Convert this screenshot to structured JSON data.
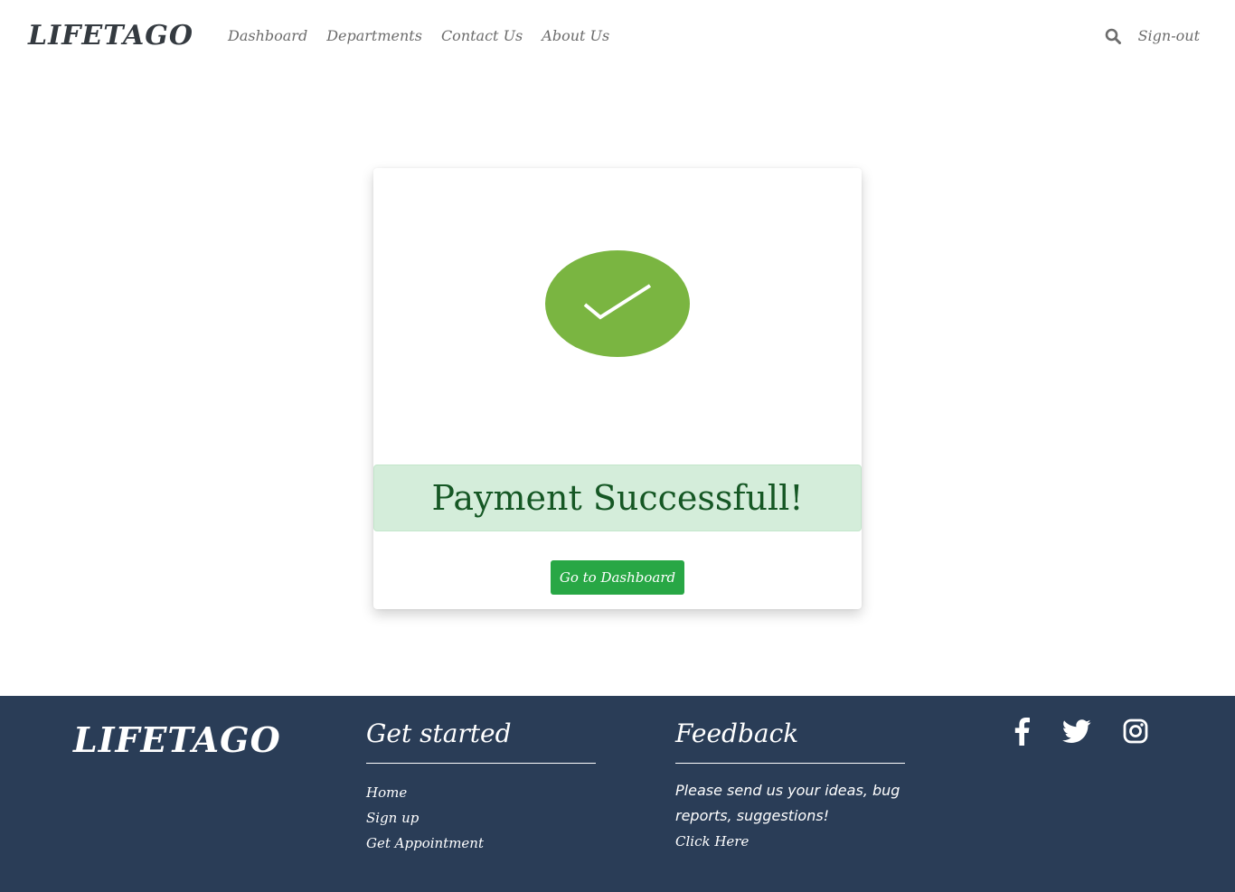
{
  "header": {
    "brand": "LIFETAGO",
    "nav": [
      "Dashboard",
      "Departments",
      "Contact Us",
      "About Us"
    ],
    "search_icon": "search-icon",
    "signout": "Sign-out"
  },
  "card": {
    "icon": "check-icon",
    "message": "Payment Successfull!",
    "button_label": "Go to Dashboard",
    "colors": {
      "badge": "#7ab541",
      "alert_bg": "#d4edda",
      "alert_text": "#155724",
      "button": "#28a745"
    }
  },
  "footer": {
    "brand": "LIFETAGO",
    "get_started": {
      "title": "Get started",
      "links": [
        "Home",
        "Sign up",
        "Get Appointment"
      ]
    },
    "feedback": {
      "title": "Feedback",
      "text": "Please send us your ideas, bug reports, suggestions!",
      "link": "Click Here"
    },
    "socials": [
      "facebook-icon",
      "twitter-icon",
      "instagram-icon"
    ],
    "background": "#2a3d57"
  }
}
